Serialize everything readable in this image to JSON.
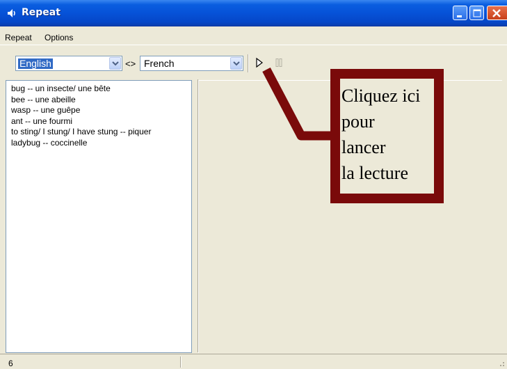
{
  "window": {
    "title": "Repeat"
  },
  "menu": [
    "Repeat",
    "Options"
  ],
  "toolbar": {
    "source_language": "English",
    "target_language": "French",
    "swap_symbol": "<>"
  },
  "text_lines": [
    "bug -- un insecte/ une bête",
    "bee -- une abeille",
    "wasp -- une guêpe",
    "ant -- une fourmi",
    "to sting/ I stung/ I have stung -- piquer",
    "ladybug -- coccinelle"
  ],
  "status": {
    "count": "6"
  },
  "annotation": {
    "lines": [
      "Cliquez ici",
      "pour",
      "lancer",
      "la lecture"
    ],
    "color": "#7a0a0a"
  }
}
